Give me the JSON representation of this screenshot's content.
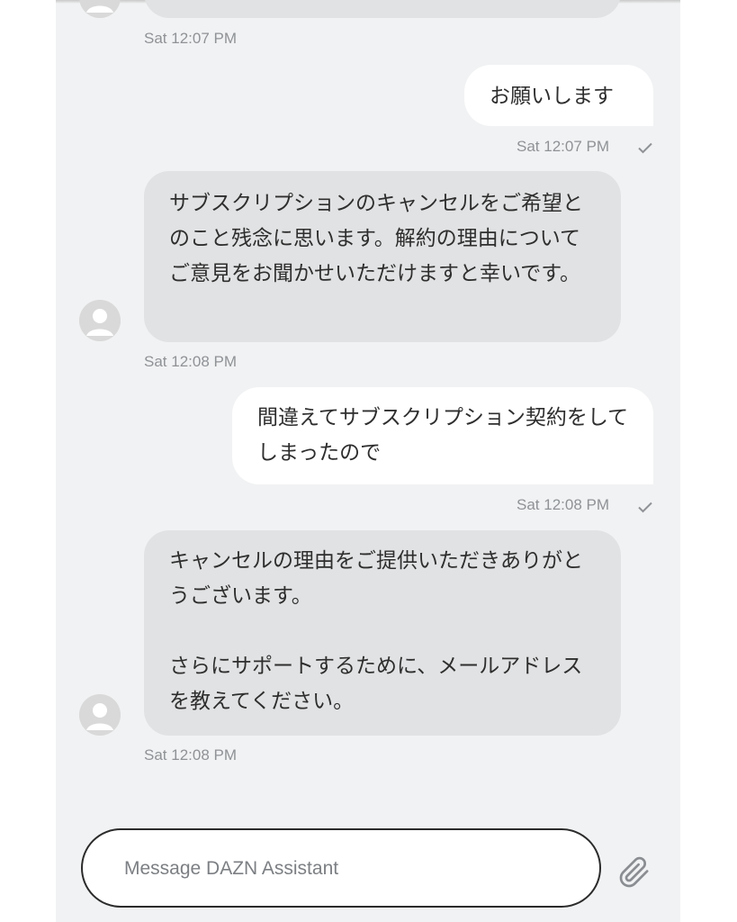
{
  "messages": [
    {
      "sender": "agent",
      "text": "",
      "time": "Sat 12:07 PM"
    },
    {
      "sender": "user",
      "text": "お願いします",
      "time": "Sat 12:07 PM",
      "status": "sent"
    },
    {
      "sender": "agent",
      "text": "サブスクリプションのキャンセルをご希望とのこと残念に思います。解約の理由についてご意見をお聞かせいただけますと幸いです。",
      "time": "Sat 12:08 PM"
    },
    {
      "sender": "user",
      "text": "間違えてサブスクリプション契約をしてしまったので",
      "time": "Sat 12:08 PM",
      "status": "sent"
    },
    {
      "sender": "agent",
      "text": "キャンセルの理由をご提供いただきありがとうございます。\n\nさらにサポートするために、メールアドレスを教えてください。",
      "time": "Sat 12:08 PM"
    }
  ],
  "composer": {
    "placeholder": "Message DAZN Assistant",
    "value": ""
  },
  "icons": {
    "avatar": "user-avatar-icon",
    "check": "checkmark-icon",
    "attach": "paperclip-icon"
  },
  "colors": {
    "background": "#f1f2f3",
    "agent_bubble": "#e1e2e3",
    "user_bubble": "#ffffff",
    "timestamp": "#8f9296"
  }
}
